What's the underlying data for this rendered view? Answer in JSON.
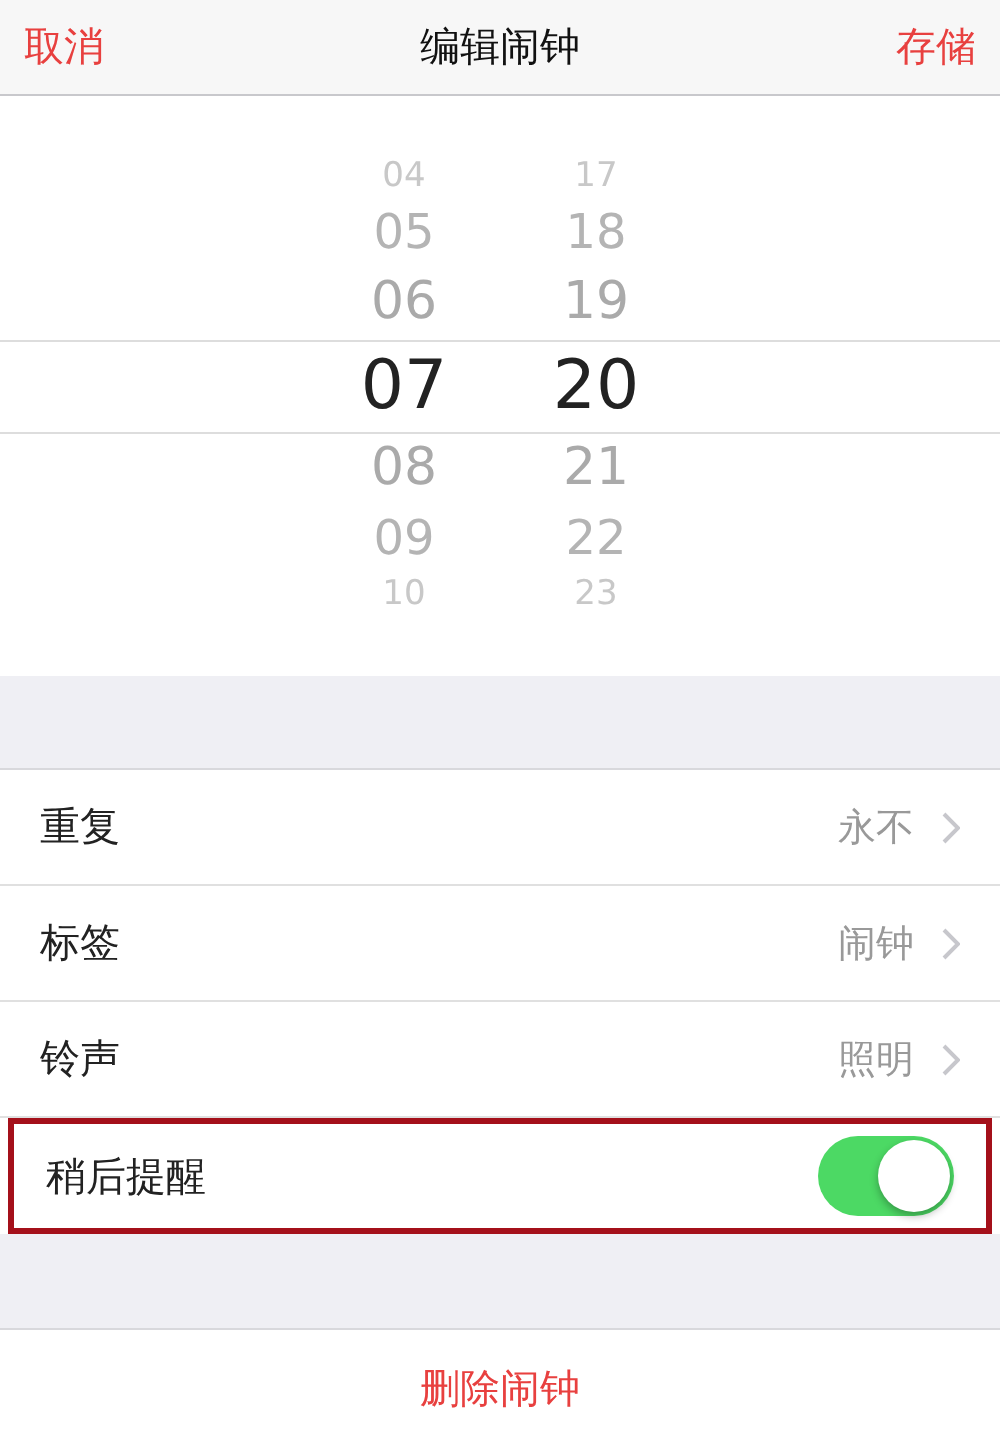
{
  "nav_bar": {
    "cancel": "取消",
    "title": "编辑闹钟",
    "save": "存储"
  },
  "time_picker": {
    "hours": [
      {
        "value": "04",
        "selected": false
      },
      {
        "value": "05",
        "selected": false
      },
      {
        "value": "06",
        "selected": false
      },
      {
        "value": "07",
        "selected": true
      },
      {
        "value": "08",
        "selected": false
      },
      {
        "value": "09",
        "selected": false
      },
      {
        "value": "10",
        "selected": false
      }
    ],
    "minutes": [
      {
        "value": "17",
        "selected": false
      },
      {
        "value": "18",
        "selected": false
      },
      {
        "value": "19",
        "selected": false
      },
      {
        "value": "20",
        "selected": true
      },
      {
        "value": "21",
        "selected": false
      },
      {
        "value": "22",
        "selected": false
      },
      {
        "value": "23",
        "selected": false
      }
    ]
  },
  "settings": [
    {
      "kind": "link",
      "label": "重复",
      "value": "永不",
      "highlighted": false
    },
    {
      "kind": "link",
      "label": "标签",
      "value": "闹钟",
      "highlighted": false
    },
    {
      "kind": "link",
      "label": "铃声",
      "value": "照明",
      "highlighted": false
    },
    {
      "kind": "toggle",
      "label": "稍后提醒",
      "on": true,
      "highlighted": true
    }
  ],
  "delete_button": "删除闹钟"
}
